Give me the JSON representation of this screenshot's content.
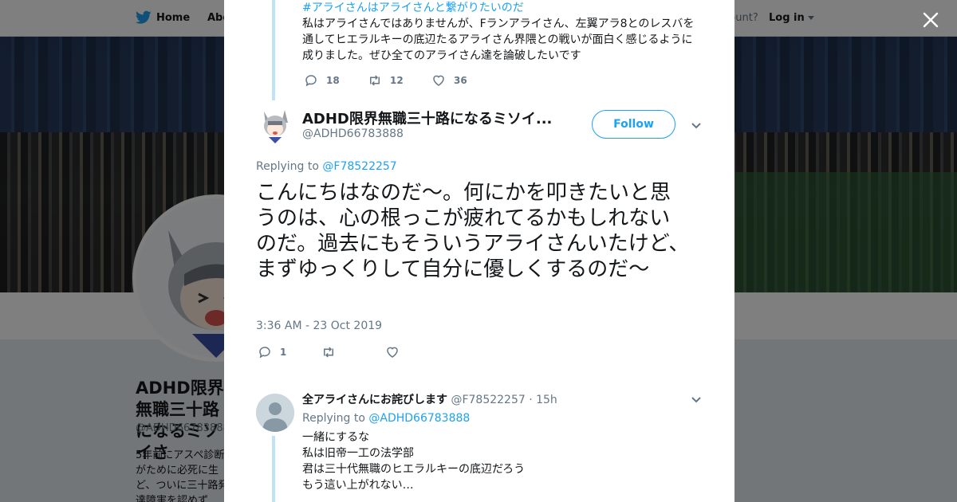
{
  "background": {
    "nav": {
      "home": "Home",
      "about": "Abo",
      "account_text": "ccount?",
      "login": "Log in"
    },
    "profile": {
      "name": "ADHD限界無職三十路になるミソイさ",
      "handle": "@ADHD66783888",
      "bio": "5年前にアスペ診断がために必死に生ど、ついに三十路発達障害を認めず"
    }
  },
  "previous_tweet": {
    "hashtag": "#アライさんはアライさんと繋がりたいのだ",
    "text_lines": [
      "私はアライさんではありませんが、Fランアライさん、左翼アラ8とのレスバを",
      "通してヒエラルキーの底辺たるアライさん界隈との戦いが面白く感じるように",
      "成りました。ぜひ全てのアライさん達を論破したいです"
    ],
    "replies": "18",
    "retweets": "12",
    "likes": "36"
  },
  "main_tweet": {
    "name": "ADHD限界無職三十路になるミソイ...",
    "handle": "@ADHD66783888",
    "follow_label": "Follow",
    "replying_prefix": "Replying to",
    "replying_to": "@F78522257",
    "text": "こんにちはなのだ〜。何にかを叩きたいと思うのは、心の根っこが疲れてるかもしれないのだ。過去にもそういうアライさんいたけど、まずゆっくりして自分に優しくするのだ〜",
    "timestamp": "3:36 AM - 23 Oct 2019",
    "replies": "1",
    "retweets": "",
    "likes": ""
  },
  "reply_tweet": {
    "name": "全アライさんにお詫びします",
    "handle": "@F78522257",
    "time": "· 15h",
    "replying_prefix": "Replying to",
    "replying_to": "@ADHD66783888",
    "lines": [
      "一緒にするな",
      "私は旧帝一工の法学部",
      "君は三十代無職のヒエラルキーの底辺だろう",
      "もう這い上がれない…"
    ]
  },
  "colors": {
    "accent": "#1da1f2",
    "text": "#14171a",
    "muted": "#657786",
    "thread": "#bfe3f9"
  },
  "icons": [
    "twitter-bird-icon",
    "close-icon",
    "reply-icon",
    "retweet-icon",
    "like-icon",
    "chevron-down-icon",
    "default-avatar-icon"
  ]
}
